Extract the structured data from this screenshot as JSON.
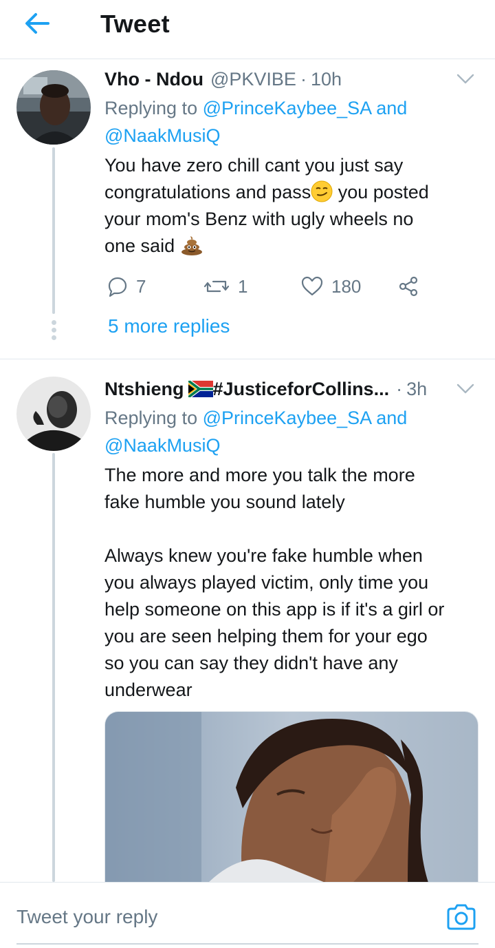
{
  "header": {
    "title": "Tweet"
  },
  "tweets": [
    {
      "display_name": "Vho - Ndou",
      "handle": "@PKVIBE",
      "separator": "·",
      "time": "10h",
      "replying_prefix": "Replying to",
      "mention_1": "@PrinceKaybee_SA",
      "conjunction": "and",
      "mention_2": "@NaakMusiQ",
      "text": {
        "line1": "You have zero chill cant you  just  say",
        "line2a": "congratulations and pass",
        "line2b": " you posted",
        "line3": "your mom's Benz with ugly wheels  no",
        "line4": "one said "
      },
      "replies": "7",
      "retweets": "1",
      "likes": "180",
      "more_replies": "5 more replies"
    },
    {
      "display_name": "Ntshieng",
      "display_name_suffix": "#JusticeforCollins...",
      "separator": "·",
      "time": "3h",
      "replying_prefix": "Replying to",
      "mention_1": "@PrinceKaybee_SA",
      "conjunction": "and",
      "mention_2": "@NaakMusiQ",
      "text": {
        "line1": "The more and more you talk the more",
        "line2": "fake humble you sound lately",
        "line3": "Always knew you're fake humble when",
        "line4": "you always played victim, only time you",
        "line5": "help someone on this app is if it's a girl or",
        "line6": "you are seen helping them for your ego",
        "line7": "so you can say they didn't have any",
        "line8": "underwear"
      }
    }
  ],
  "composer": {
    "placeholder": "Tweet your reply"
  },
  "colors": {
    "accent": "#1da1f2",
    "secondary_text": "#657786",
    "primary_text": "#14171a",
    "divider": "#e1e8ed"
  },
  "icons": [
    "back-arrow-icon",
    "chevron-down-icon",
    "reply-icon",
    "retweet-icon",
    "like-icon",
    "share-icon",
    "camera-icon",
    "smirk-emoji-icon",
    "poop-emoji-icon",
    "south-africa-flag-icon"
  ]
}
